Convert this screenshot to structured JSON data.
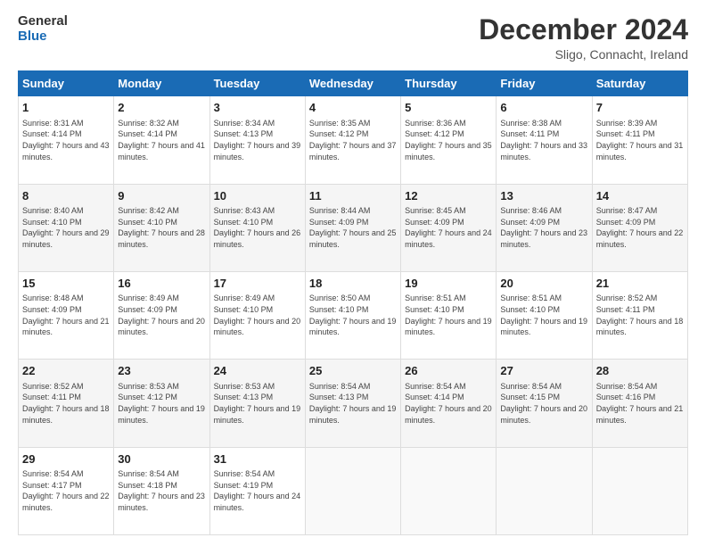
{
  "header": {
    "logo_line1": "General",
    "logo_line2": "Blue",
    "month_title": "December 2024",
    "subtitle": "Sligo, Connacht, Ireland"
  },
  "weekdays": [
    "Sunday",
    "Monday",
    "Tuesday",
    "Wednesday",
    "Thursday",
    "Friday",
    "Saturday"
  ],
  "weeks": [
    [
      {
        "day": "1",
        "sunrise": "Sunrise: 8:31 AM",
        "sunset": "Sunset: 4:14 PM",
        "daylight": "Daylight: 7 hours and 43 minutes."
      },
      {
        "day": "2",
        "sunrise": "Sunrise: 8:32 AM",
        "sunset": "Sunset: 4:14 PM",
        "daylight": "Daylight: 7 hours and 41 minutes."
      },
      {
        "day": "3",
        "sunrise": "Sunrise: 8:34 AM",
        "sunset": "Sunset: 4:13 PM",
        "daylight": "Daylight: 7 hours and 39 minutes."
      },
      {
        "day": "4",
        "sunrise": "Sunrise: 8:35 AM",
        "sunset": "Sunset: 4:12 PM",
        "daylight": "Daylight: 7 hours and 37 minutes."
      },
      {
        "day": "5",
        "sunrise": "Sunrise: 8:36 AM",
        "sunset": "Sunset: 4:12 PM",
        "daylight": "Daylight: 7 hours and 35 minutes."
      },
      {
        "day": "6",
        "sunrise": "Sunrise: 8:38 AM",
        "sunset": "Sunset: 4:11 PM",
        "daylight": "Daylight: 7 hours and 33 minutes."
      },
      {
        "day": "7",
        "sunrise": "Sunrise: 8:39 AM",
        "sunset": "Sunset: 4:11 PM",
        "daylight": "Daylight: 7 hours and 31 minutes."
      }
    ],
    [
      {
        "day": "8",
        "sunrise": "Sunrise: 8:40 AM",
        "sunset": "Sunset: 4:10 PM",
        "daylight": "Daylight: 7 hours and 29 minutes."
      },
      {
        "day": "9",
        "sunrise": "Sunrise: 8:42 AM",
        "sunset": "Sunset: 4:10 PM",
        "daylight": "Daylight: 7 hours and 28 minutes."
      },
      {
        "day": "10",
        "sunrise": "Sunrise: 8:43 AM",
        "sunset": "Sunset: 4:10 PM",
        "daylight": "Daylight: 7 hours and 26 minutes."
      },
      {
        "day": "11",
        "sunrise": "Sunrise: 8:44 AM",
        "sunset": "Sunset: 4:09 PM",
        "daylight": "Daylight: 7 hours and 25 minutes."
      },
      {
        "day": "12",
        "sunrise": "Sunrise: 8:45 AM",
        "sunset": "Sunset: 4:09 PM",
        "daylight": "Daylight: 7 hours and 24 minutes."
      },
      {
        "day": "13",
        "sunrise": "Sunrise: 8:46 AM",
        "sunset": "Sunset: 4:09 PM",
        "daylight": "Daylight: 7 hours and 23 minutes."
      },
      {
        "day": "14",
        "sunrise": "Sunrise: 8:47 AM",
        "sunset": "Sunset: 4:09 PM",
        "daylight": "Daylight: 7 hours and 22 minutes."
      }
    ],
    [
      {
        "day": "15",
        "sunrise": "Sunrise: 8:48 AM",
        "sunset": "Sunset: 4:09 PM",
        "daylight": "Daylight: 7 hours and 21 minutes."
      },
      {
        "day": "16",
        "sunrise": "Sunrise: 8:49 AM",
        "sunset": "Sunset: 4:09 PM",
        "daylight": "Daylight: 7 hours and 20 minutes."
      },
      {
        "day": "17",
        "sunrise": "Sunrise: 8:49 AM",
        "sunset": "Sunset: 4:10 PM",
        "daylight": "Daylight: 7 hours and 20 minutes."
      },
      {
        "day": "18",
        "sunrise": "Sunrise: 8:50 AM",
        "sunset": "Sunset: 4:10 PM",
        "daylight": "Daylight: 7 hours and 19 minutes."
      },
      {
        "day": "19",
        "sunrise": "Sunrise: 8:51 AM",
        "sunset": "Sunset: 4:10 PM",
        "daylight": "Daylight: 7 hours and 19 minutes."
      },
      {
        "day": "20",
        "sunrise": "Sunrise: 8:51 AM",
        "sunset": "Sunset: 4:10 PM",
        "daylight": "Daylight: 7 hours and 19 minutes."
      },
      {
        "day": "21",
        "sunrise": "Sunrise: 8:52 AM",
        "sunset": "Sunset: 4:11 PM",
        "daylight": "Daylight: 7 hours and 18 minutes."
      }
    ],
    [
      {
        "day": "22",
        "sunrise": "Sunrise: 8:52 AM",
        "sunset": "Sunset: 4:11 PM",
        "daylight": "Daylight: 7 hours and 18 minutes."
      },
      {
        "day": "23",
        "sunrise": "Sunrise: 8:53 AM",
        "sunset": "Sunset: 4:12 PM",
        "daylight": "Daylight: 7 hours and 19 minutes."
      },
      {
        "day": "24",
        "sunrise": "Sunrise: 8:53 AM",
        "sunset": "Sunset: 4:13 PM",
        "daylight": "Daylight: 7 hours and 19 minutes."
      },
      {
        "day": "25",
        "sunrise": "Sunrise: 8:54 AM",
        "sunset": "Sunset: 4:13 PM",
        "daylight": "Daylight: 7 hours and 19 minutes."
      },
      {
        "day": "26",
        "sunrise": "Sunrise: 8:54 AM",
        "sunset": "Sunset: 4:14 PM",
        "daylight": "Daylight: 7 hours and 20 minutes."
      },
      {
        "day": "27",
        "sunrise": "Sunrise: 8:54 AM",
        "sunset": "Sunset: 4:15 PM",
        "daylight": "Daylight: 7 hours and 20 minutes."
      },
      {
        "day": "28",
        "sunrise": "Sunrise: 8:54 AM",
        "sunset": "Sunset: 4:16 PM",
        "daylight": "Daylight: 7 hours and 21 minutes."
      }
    ],
    [
      {
        "day": "29",
        "sunrise": "Sunrise: 8:54 AM",
        "sunset": "Sunset: 4:17 PM",
        "daylight": "Daylight: 7 hours and 22 minutes."
      },
      {
        "day": "30",
        "sunrise": "Sunrise: 8:54 AM",
        "sunset": "Sunset: 4:18 PM",
        "daylight": "Daylight: 7 hours and 23 minutes."
      },
      {
        "day": "31",
        "sunrise": "Sunrise: 8:54 AM",
        "sunset": "Sunset: 4:19 PM",
        "daylight": "Daylight: 7 hours and 24 minutes."
      },
      null,
      null,
      null,
      null
    ]
  ]
}
